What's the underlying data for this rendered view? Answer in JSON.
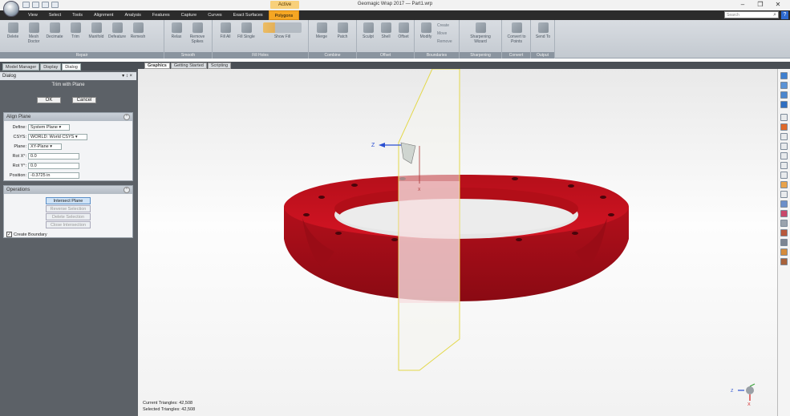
{
  "window": {
    "title": "Geomagic Wrap 2017 — Part1.wrp",
    "context_tab": "Active"
  },
  "window_controls": {
    "minimize": "–",
    "restore": "❐",
    "close": "✕"
  },
  "menu": {
    "tabs": [
      "View",
      "Select",
      "Tools",
      "Alignment",
      "Analysis",
      "Features",
      "Capture",
      "Curves",
      "Exact Surfaces",
      "Polygons"
    ],
    "active": "Polygons"
  },
  "search": {
    "placeholder": "Search"
  },
  "ribbon": {
    "groups": [
      {
        "label": "Repair",
        "buttons": [
          "Delete",
          "Mesh Doctor",
          "Decimate",
          "Trim",
          "Manifold",
          "Defeature",
          "Remesh"
        ]
      },
      {
        "label": "Smooth",
        "buttons": [
          "Relax",
          "Remove Spikes"
        ]
      },
      {
        "label": "Fill Holes",
        "buttons": [
          "Fill All",
          "Fill Single",
          "Show Fill"
        ]
      },
      {
        "label": "Combine",
        "buttons": [
          "Merge",
          "Patch"
        ]
      },
      {
        "label": "Offset",
        "buttons": [
          "Sculpt",
          "Shell",
          "Offset"
        ]
      },
      {
        "label": "Boundaries",
        "buttons": [
          "Modify",
          "Create",
          "Move",
          "Remove"
        ]
      },
      {
        "label": "Sharpening",
        "buttons": [
          "Sharpening Wizard"
        ]
      },
      {
        "label": "Convert",
        "buttons": [
          "Convert to Points"
        ]
      },
      {
        "label": "Output",
        "buttons": [
          "Send To"
        ]
      }
    ]
  },
  "left_tabs": [
    "Model Manager",
    "Display",
    "Dialog"
  ],
  "left_tab_active": "Dialog",
  "view_tabs": [
    "Graphics",
    "Getting Started",
    "Scripting"
  ],
  "view_tab_active": "Graphics",
  "dialog": {
    "header": "Dialog",
    "pin": "▾ ↕ ×",
    "title": "Trim with Plane",
    "ok": "OK",
    "cancel": "Cancel"
  },
  "align_plane": {
    "title": "Align Plane",
    "fields": [
      {
        "label": "Define:",
        "value": "System Plane"
      },
      {
        "label": "CSYS:",
        "value": "WORLD: World CSYS"
      },
      {
        "label": "Plane:",
        "value": "XY-Plane"
      },
      {
        "label": "Rot X°:",
        "value": "0.0"
      },
      {
        "label": "Rot Y°:",
        "value": "0.0"
      },
      {
        "label": "Position:",
        "value": "-0.3725 in"
      }
    ]
  },
  "operations": {
    "title": "Operations",
    "buttons": [
      "Intersect Plane",
      "Reverse Selection",
      "Delete Selection",
      "Close Intersection"
    ],
    "checkbox_label": "Create Boundary",
    "checkbox_checked": true
  },
  "status": {
    "current": "Current Triangles: 42,508",
    "selected": "Selected Triangles: 42,508"
  },
  "axis": {
    "z": "Z",
    "x": "X"
  },
  "colors": {
    "part": "#c8101c",
    "accent": "#f5a623",
    "plane": "#e8e8d8"
  }
}
